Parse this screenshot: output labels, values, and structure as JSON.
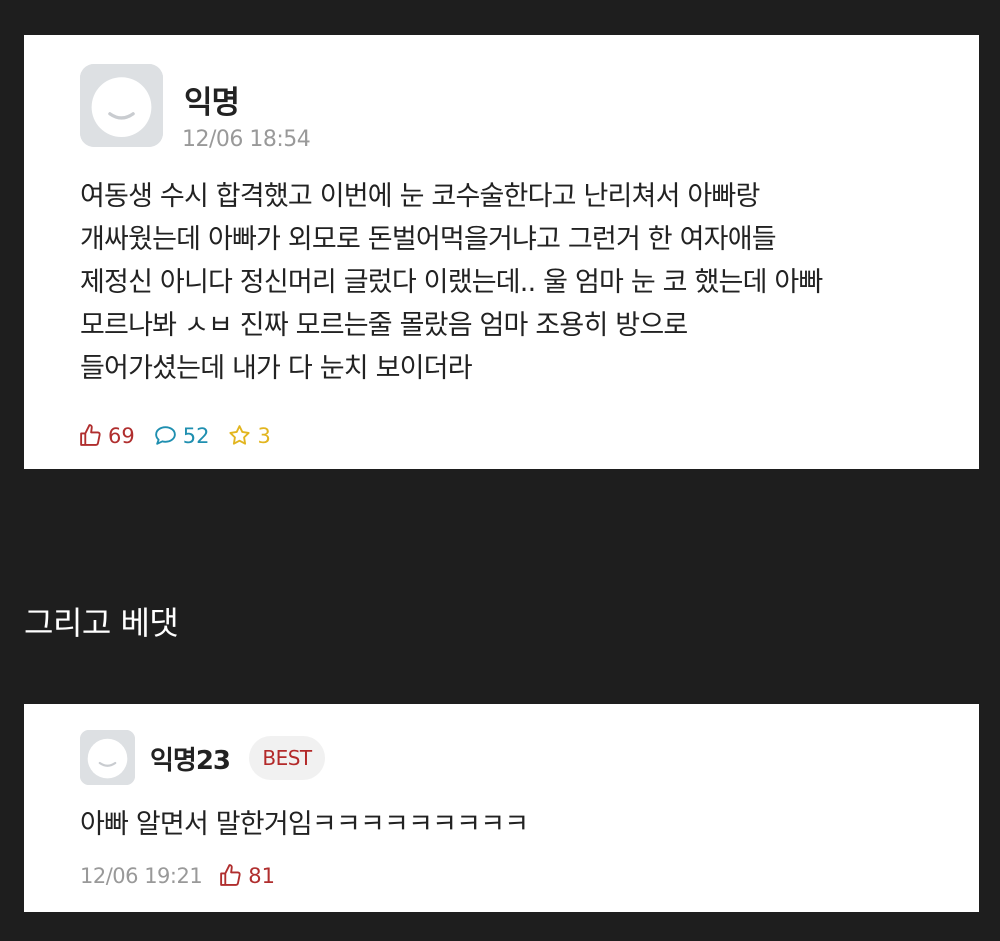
{
  "post": {
    "author": "익명",
    "timestamp": "12/06 18:54",
    "body_lines": [
      "여동생 수시 합격했고 이번에 눈 코수술한다고 난리쳐서 아빠랑",
      "개싸웠는데 아빠가 외모로 돈벌어먹을거냐고 그런거 한 여자애들",
      "제정신 아니다 정신머리 글렀다 이랬는데.. 울 엄마 눈 코 했는데 아빠",
      "모르나봐 ㅅㅂ 진짜 모르는줄 몰랐음 엄마 조용히 방으로",
      "들어가셨는데 내가 다 눈치 보이더라"
    ],
    "stats": {
      "likes": "69",
      "comments": "52",
      "scraps": "3"
    },
    "colors": {
      "like": "#b02e2e",
      "comment": "#1f8fb0",
      "scrap": "#e2b51f"
    }
  },
  "caption": "그리고 베댓",
  "comment": {
    "author": "익명23",
    "badge": "BEST",
    "body": "아빠 알면서 말한거임ㅋㅋㅋㅋㅋㅋㅋㅋㅋ",
    "timestamp": "12/06 19:21",
    "likes": "81"
  },
  "icons": {
    "avatar": "default-avatar-icon",
    "like": "thumbs-up-icon",
    "comment": "speech-bubble-icon",
    "scrap": "star-icon"
  }
}
